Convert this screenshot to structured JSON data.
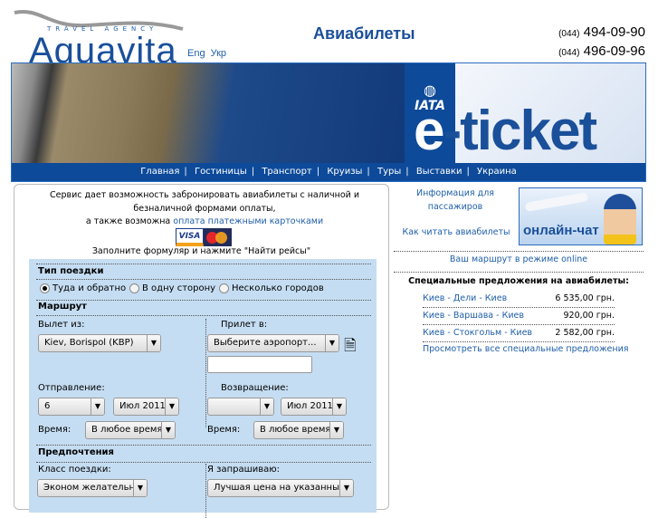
{
  "header": {
    "logo_sub": "TRAVEL AGENCY",
    "logo_name": "Aquavita",
    "lang": [
      "Eng",
      "Укр"
    ],
    "title": "Авиабилеты",
    "phones": [
      {
        "code": "(044)",
        "num": "494-09-90"
      },
      {
        "code": "(044)",
        "num": "496-09-96"
      }
    ]
  },
  "banner": {
    "iata": "IATA",
    "eticket_e": "e",
    "eticket_rest": "-ticket"
  },
  "nav": [
    "Главная",
    "Гостиницы",
    "Транспорт",
    "Круизы",
    "Туры",
    "Выставки",
    "Украина"
  ],
  "intro": {
    "line1": "Сервис дает возможность забронировать авиабилеты с наличной и безналичной формами оплаты,",
    "line2": "а также возможна ",
    "link": "оплата платежными карточками",
    "visa": "VISA",
    "hint": "Заполните формуляр и нажмите \"Найти рейсы\""
  },
  "form": {
    "trip_type": "Тип поездки",
    "radios": [
      {
        "label": "Туда и обратно",
        "checked": true
      },
      {
        "label": "В одну сторону",
        "checked": false
      },
      {
        "label": "Несколько городов",
        "checked": false
      }
    ],
    "route": "Маршрут",
    "from_label": "Вылет из:",
    "from_value": "Kiev, Borispol (KBP)",
    "to_label": "Прилет в:",
    "to_value": "Выберите аэропорт...",
    "to_text": "",
    "depart_label": "Отправление:",
    "depart_day": "6",
    "depart_month": "Июл 2011",
    "return_label": "Возвращение:",
    "return_day": "",
    "return_month": "Июл 2011",
    "time_label": "Время:",
    "time_value": "В любое время",
    "return_time_value": "В любое время",
    "prefs": "Предпочтения",
    "class_label": "Класс поездки:",
    "class_value": "Эконом желательно",
    "request_label": "Я запрашиваю:",
    "request_value": "Лучшая цена на указанные даты"
  },
  "right": {
    "info": "Информация для пассажиров",
    "howto": "Как читать авиабилеты",
    "chat": "онлайн-чат",
    "route_online": "Ваш маршрут в режиме online",
    "offers_title": "Специальные предложения на авиабилеты:",
    "offers": [
      {
        "route": "Киев - Дели - Киев",
        "price": "6 535,00 грн."
      },
      {
        "route": "Киев - Варшава - Киев",
        "price": "920,00 грн."
      },
      {
        "route": "Киев - Стокгольм - Киев",
        "price": "2 582,00 грн."
      }
    ],
    "all_offers": "Просмотреть все специальные предложения"
  }
}
